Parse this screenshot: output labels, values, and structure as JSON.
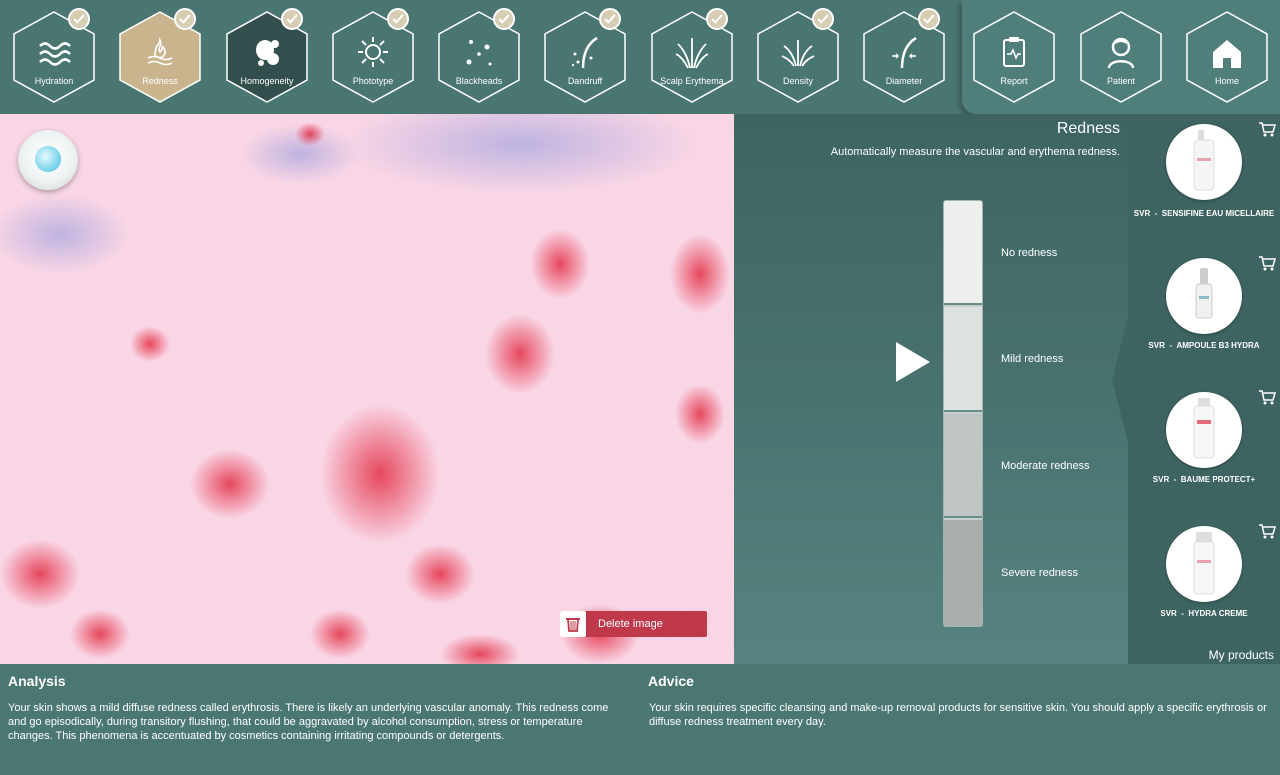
{
  "nav": {
    "items": [
      {
        "label": "Hydration",
        "icon": "waves-icon",
        "checked": true,
        "active": false
      },
      {
        "label": "Redness",
        "icon": "flame-icon",
        "checked": true,
        "active": true
      },
      {
        "label": "Homogeneity",
        "icon": "blobs-icon",
        "checked": true,
        "active": false
      },
      {
        "label": "Phototype",
        "icon": "sun-icon",
        "checked": true,
        "active": false
      },
      {
        "label": "Blackheads",
        "icon": "dots-icon",
        "checked": true,
        "active": false
      },
      {
        "label": "Dandruff",
        "icon": "hair-flakes-icon",
        "checked": true,
        "active": false
      },
      {
        "label": "Scalp Erythema",
        "icon": "hair-bundle-icon",
        "checked": true,
        "active": false
      },
      {
        "label": "Density",
        "icon": "hair-bundle-icon",
        "checked": true,
        "active": false
      },
      {
        "label": "Diameter",
        "icon": "hair-diameter-icon",
        "checked": true,
        "active": false
      }
    ],
    "right_items": [
      {
        "label": "Report",
        "icon": "clipboard-icon"
      },
      {
        "label": "Patient",
        "icon": "patient-icon"
      },
      {
        "label": "Home",
        "icon": "home-icon"
      }
    ]
  },
  "image_panel": {
    "delete_label": "Delete image"
  },
  "measure": {
    "title": "Redness",
    "description": "Automatically measure the vascular and erythema redness.",
    "scale_labels": [
      "No redness",
      "Mild redness",
      "Moderate redness",
      "Severe redness"
    ],
    "current_level": "Mild redness"
  },
  "products": {
    "items": [
      {
        "brand": "SVR",
        "name": "SENSIFINE EAU MICELLAIRE"
      },
      {
        "brand": "SVR",
        "name": "AMPOULE B3 HYDRA"
      },
      {
        "brand": "SVR",
        "name": "BAUME PROTECT+"
      },
      {
        "brand": "SVR",
        "name": "HYDRA CREME"
      }
    ],
    "footer_label": "My products"
  },
  "analysis": {
    "title": "Analysis",
    "text": "Your skin shows a mild diffuse redness called erythrosis. There is likely an underlying vascular anomaly. This redness come and go episodically, during transitory flushing, that could be aggravated by alcohol consumption, stress or temperature changes. This phenomena is accentuated by cosmetics containing irritating compounds or detergents."
  },
  "advice": {
    "title": "Advice",
    "text": "Your skin requires specific cleansing and make-up removal products for sensitive skin. You should apply a specific erythrosis or diffuse redness treatment every day."
  },
  "colors": {
    "active_tab": "#c9b48e",
    "dark_tab": "#324f4d",
    "delete": "#c0394a"
  }
}
